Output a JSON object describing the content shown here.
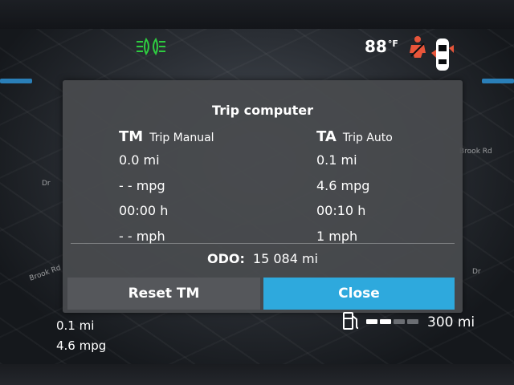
{
  "status_bar": {
    "outside_temp": "88",
    "temp_unit": "°F",
    "headlight_icon": "headlight-icon",
    "seatbelt_icon": "seatbelt-warning-icon",
    "car_icon": "car-door-open-icon",
    "colors": {
      "headlight": "#2ecc40",
      "seatbelt": "#e8553a"
    }
  },
  "map_labels": [
    "Brook Rd",
    "Dr",
    "Brook Rd",
    "Dr"
  ],
  "dialog": {
    "title": "Trip computer",
    "trip_manual": {
      "abbr": "TM",
      "name": "Trip Manual",
      "distance": "0.0 mi",
      "economy": "- - mpg",
      "duration": "00:00 h",
      "speed": "- - mph"
    },
    "trip_auto": {
      "abbr": "TA",
      "name": "Trip Auto",
      "distance": "0.1 mi",
      "economy": "4.6 mpg",
      "duration": "00:10 h",
      "speed": "1 mph"
    },
    "odometer": {
      "label": "ODO:",
      "value": "15 084 mi"
    },
    "reset_button": "Reset TM",
    "close_button": "Close",
    "colors": {
      "close_button": "#2ea9dd",
      "reset_button": "#55575b"
    }
  },
  "bottom": {
    "trip_distance": "0.1 mi",
    "trip_economy": "4.6 mpg",
    "fuel_icon": "fuel-pump-icon",
    "fuel_level_fraction": 0.5,
    "range": "300 mi"
  }
}
